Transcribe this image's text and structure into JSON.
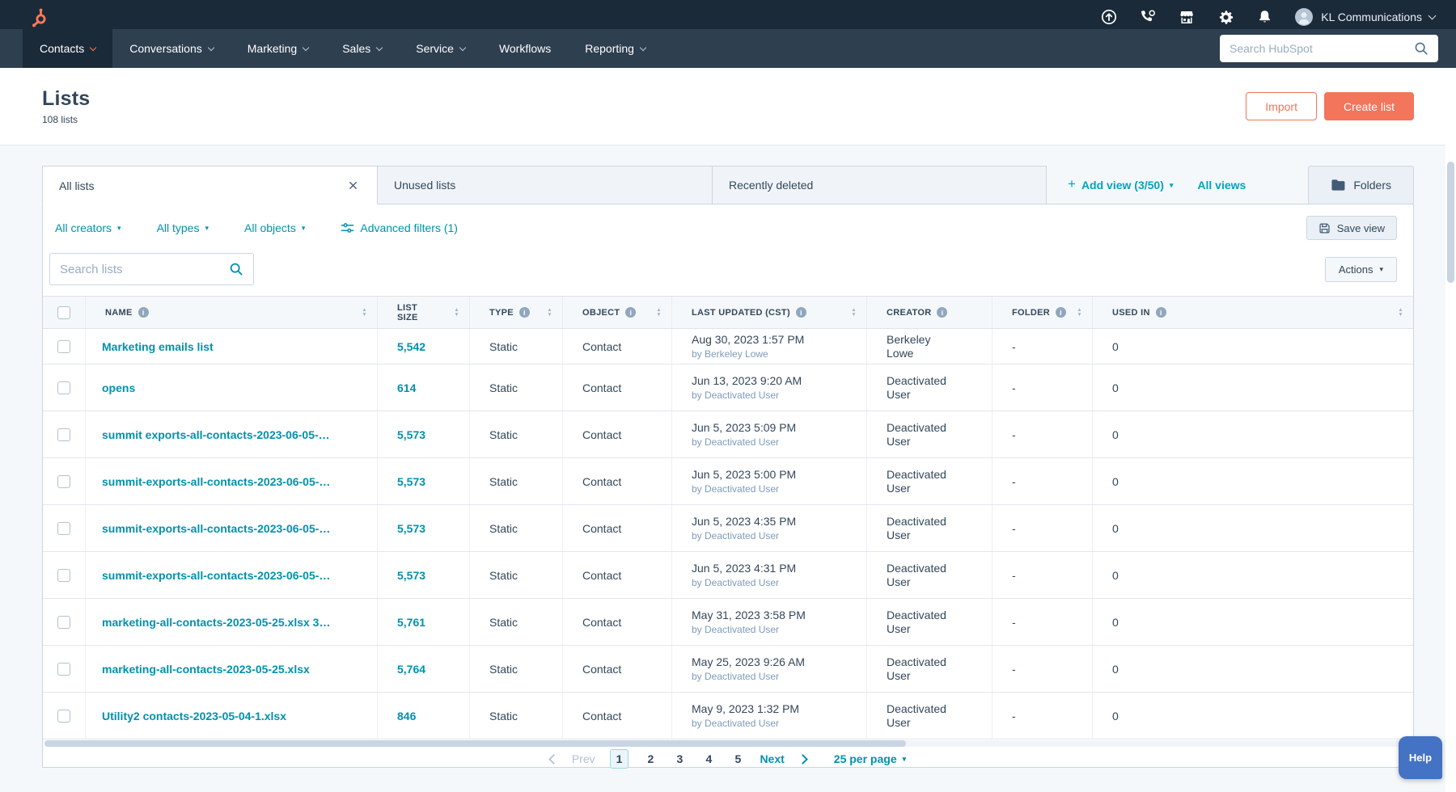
{
  "topbar": {
    "search_placeholder": "Search HubSpot",
    "account_name": "KL Communications"
  },
  "nav": {
    "items": [
      {
        "label": "Contacts",
        "dropdown": true,
        "active": true
      },
      {
        "label": "Conversations",
        "dropdown": true,
        "active": false
      },
      {
        "label": "Marketing",
        "dropdown": true,
        "active": false
      },
      {
        "label": "Sales",
        "dropdown": true,
        "active": false
      },
      {
        "label": "Service",
        "dropdown": true,
        "active": false
      },
      {
        "label": "Workflows",
        "dropdown": false,
        "active": false
      },
      {
        "label": "Reporting",
        "dropdown": true,
        "active": false
      }
    ]
  },
  "page_header": {
    "title": "Lists",
    "subtitle": "108 lists",
    "import_label": "Import",
    "create_label": "Create list"
  },
  "views": {
    "tabs": [
      "All lists",
      "Unused lists",
      "Recently deleted"
    ],
    "add_view_label": "Add view (3/50)",
    "all_views_label": "All views",
    "folders_label": "Folders"
  },
  "filters": {
    "creators_label": "All creators",
    "types_label": "All types",
    "objects_label": "All objects",
    "advanced_label": "Advanced filters (1)",
    "save_view_label": "Save view"
  },
  "toolbar": {
    "search_placeholder": "Search lists",
    "actions_label": "Actions"
  },
  "table": {
    "headers": [
      {
        "label": "NAME",
        "info": true,
        "sort": true
      },
      {
        "label": "LIST SIZE",
        "info": false,
        "sort": true
      },
      {
        "label": "TYPE",
        "info": true,
        "sort": true
      },
      {
        "label": "OBJECT",
        "info": true,
        "sort": true
      },
      {
        "label": "LAST UPDATED (CST)",
        "info": true,
        "sort": true
      },
      {
        "label": "CREATOR",
        "info": true,
        "sort": false
      },
      {
        "label": "FOLDER",
        "info": true,
        "sort": true
      },
      {
        "label": "USED IN",
        "info": true,
        "sort": true
      }
    ],
    "rows": [
      {
        "name": "Marketing emails list",
        "size": "5,542",
        "type": "Static",
        "object": "Contact",
        "updated": "Aug 30, 2023 1:57 PM",
        "updated_by": "by Berkeley Lowe",
        "creator": "Berkeley Lowe",
        "folder": "-",
        "used_in": "0"
      },
      {
        "name": "opens",
        "size": "614",
        "type": "Static",
        "object": "Contact",
        "updated": "Jun 13, 2023 9:20 AM",
        "updated_by": "by Deactivated User",
        "creator": "Deactivated User",
        "folder": "-",
        "used_in": "0"
      },
      {
        "name": "summit exports-all-contacts-2023-06-05-…",
        "size": "5,573",
        "type": "Static",
        "object": "Contact",
        "updated": "Jun 5, 2023 5:09 PM",
        "updated_by": "by Deactivated User",
        "creator": "Deactivated User",
        "folder": "-",
        "used_in": "0"
      },
      {
        "name": "summit-exports-all-contacts-2023-06-05-…",
        "size": "5,573",
        "type": "Static",
        "object": "Contact",
        "updated": "Jun 5, 2023 5:00 PM",
        "updated_by": "by Deactivated User",
        "creator": "Deactivated User",
        "folder": "-",
        "used_in": "0"
      },
      {
        "name": "summit-exports-all-contacts-2023-06-05-…",
        "size": "5,573",
        "type": "Static",
        "object": "Contact",
        "updated": "Jun 5, 2023 4:35 PM",
        "updated_by": "by Deactivated User",
        "creator": "Deactivated User",
        "folder": "-",
        "used_in": "0"
      },
      {
        "name": "summit-exports-all-contacts-2023-06-05-…",
        "size": "5,573",
        "type": "Static",
        "object": "Contact",
        "updated": "Jun 5, 2023 4:31 PM",
        "updated_by": "by Deactivated User",
        "creator": "Deactivated User",
        "folder": "-",
        "used_in": "0"
      },
      {
        "name": "marketing-all-contacts-2023-05-25.xlsx 3…",
        "size": "5,761",
        "type": "Static",
        "object": "Contact",
        "updated": "May 31, 2023 3:58 PM",
        "updated_by": "by Deactivated User",
        "creator": "Deactivated User",
        "folder": "-",
        "used_in": "0"
      },
      {
        "name": "marketing-all-contacts-2023-05-25.xlsx",
        "size": "5,764",
        "type": "Static",
        "object": "Contact",
        "updated": "May 25, 2023 9:26 AM",
        "updated_by": "by Deactivated User",
        "creator": "Deactivated User",
        "folder": "-",
        "used_in": "0"
      },
      {
        "name": "Utility2 contacts-2023-05-04-1.xlsx",
        "size": "846",
        "type": "Static",
        "object": "Contact",
        "updated": "May 9, 2023 1:32 PM",
        "updated_by": "by Deactivated User",
        "creator": "Deactivated User",
        "folder": "-",
        "used_in": "0"
      }
    ]
  },
  "pagination": {
    "prev_label": "Prev",
    "pages": [
      "1",
      "2",
      "3",
      "4",
      "5"
    ],
    "active_page": "1",
    "next_label": "Next",
    "per_page_label": "25 per page"
  },
  "help": {
    "label": "Help"
  },
  "colors": {
    "brand_orange": "#ff7a59",
    "button_orange": "#f2755c",
    "link_teal": "#0091ae",
    "topbar_bg": "#1b2a38",
    "nav_bg": "#2e3f50",
    "text_dark": "#33475b"
  }
}
